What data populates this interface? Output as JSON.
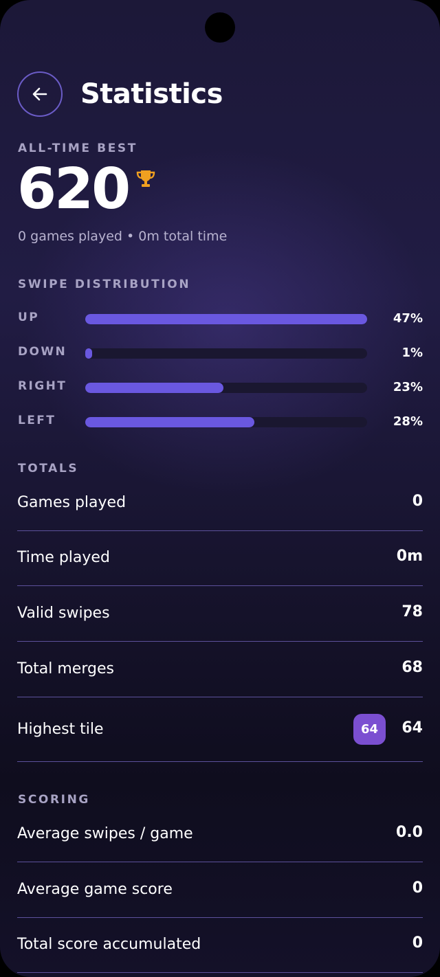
{
  "header": {
    "title": "Statistics"
  },
  "best": {
    "label": "ALL-TIME BEST",
    "score": "620",
    "summary": "0 games played • 0m total time"
  },
  "distribution": {
    "label": "SWIPE DISTRIBUTION",
    "bar_color": "#6a58e0",
    "items": [
      {
        "name": "UP",
        "percent_text": "47%",
        "fill_fraction": 1.0
      },
      {
        "name": "DOWN",
        "percent_text": "1%",
        "fill_fraction": 0.02
      },
      {
        "name": "RIGHT",
        "percent_text": "23%",
        "fill_fraction": 0.49
      },
      {
        "name": "LEFT",
        "percent_text": "28%",
        "fill_fraction": 0.6
      }
    ]
  },
  "totals": {
    "label": "TOTALS",
    "rows": [
      {
        "label": "Games played",
        "value": "0"
      },
      {
        "label": "Time played",
        "value": "0m"
      },
      {
        "label": "Valid swipes",
        "value": "78"
      },
      {
        "label": "Total merges",
        "value": "68"
      },
      {
        "label": "Highest tile",
        "value": "64",
        "tile": "64"
      }
    ]
  },
  "scoring": {
    "label": "SCORING",
    "rows": [
      {
        "label": "Average swipes / game",
        "value": "0.0"
      },
      {
        "label": "Average game score",
        "value": "0"
      },
      {
        "label": "Total score accumulated",
        "value": "0"
      }
    ]
  },
  "colors": {
    "accent": "#6a58e0",
    "tile": "#7b4fd1",
    "trophy": "#f0a020",
    "divider": "#5d519c"
  }
}
